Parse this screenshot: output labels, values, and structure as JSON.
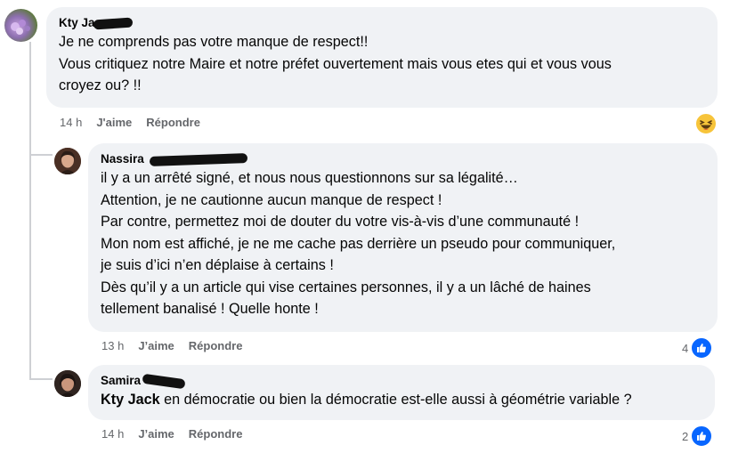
{
  "comments": [
    {
      "author": "Kty Ja",
      "lines": [
        "Je ne comprends pas votre manque de respect!!",
        "Vous critiquez notre Maire et notre préfet ouvertement mais vous etes qui et vous vous",
        "croyez ou? !!"
      ],
      "time": "14 h",
      "like_label": "J'aime",
      "reply_label": "Répondre",
      "reaction_icon": "haha-emoji-icon"
    },
    {
      "author": "Nassira",
      "lines": [
        "il y a un arrêté signé, et nous nous questionnons sur sa légalité…",
        "Attention, je ne cautionne aucun manque de respect !",
        "Par contre, permettez moi de douter du votre vis-à-vis d’une communauté !",
        "Mon nom est affiché, je ne me cache pas derrière un pseudo pour communiquer,",
        "je suis d’ici n’en déplaise à certains !",
        "Dès qu’il y a un article qui vise certaines personnes, il y a un lâché de haines",
        "tellement banalisé ! Quelle honte !"
      ],
      "time": "13 h",
      "like_label": "J’aime",
      "reply_label": "Répondre",
      "reaction_count": "4",
      "reaction_icon": "like-icon"
    },
    {
      "author": "Samira",
      "mention": "Kty Jack",
      "text": " en démocratie ou bien la démocratie est-elle aussi à géométrie variable ?",
      "time": "14 h",
      "like_label": "J’aime",
      "reply_label": "Répondre",
      "reaction_count": "2",
      "reaction_icon": "like-icon"
    }
  ],
  "colors": {
    "bubble": "#f0f2f5",
    "meta_text": "#65676b",
    "like_blue": "#0866ff",
    "thread_line": "#ced0d4"
  }
}
